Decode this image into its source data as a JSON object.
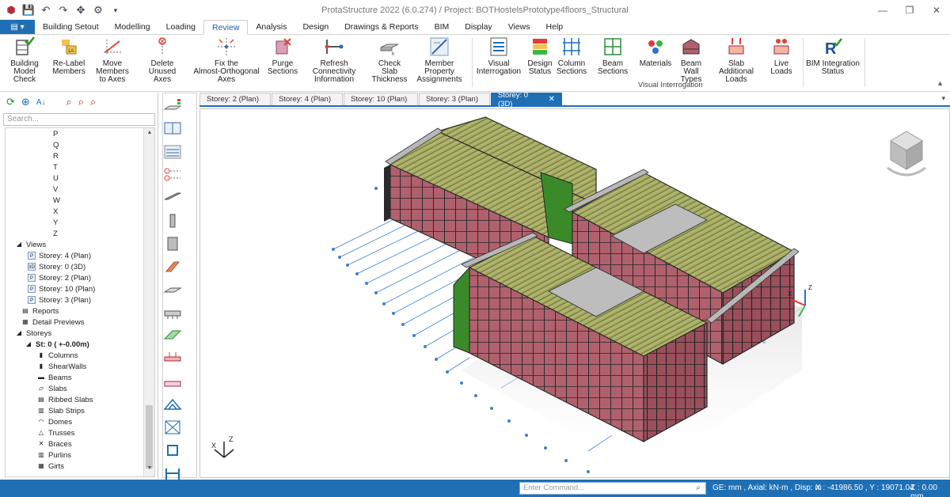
{
  "titlebar": {
    "title": "ProtaStructure 2022 (6.0.274) / Project: BOTHostelsPrototype4floors_Structural",
    "quick_icons": [
      "app-logo-icon",
      "save-icon",
      "undo-icon",
      "redo-icon",
      "tools-icon",
      "settings-icon",
      "customize-icon"
    ],
    "min": "—",
    "restore": "❐",
    "close": "✕"
  },
  "menu": {
    "file_label": "▤ ▾",
    "tabs": [
      "Building Setout",
      "Modelling",
      "Loading",
      "Review",
      "Analysis",
      "Design",
      "Drawings & Reports",
      "BIM",
      "Display",
      "Views",
      "Help"
    ],
    "active": "Review"
  },
  "ribbon": {
    "buttons": [
      {
        "id": "building-model-check",
        "line1": "Building",
        "line2": "Model Check"
      },
      {
        "id": "relabel-members",
        "line1": "Re-Label",
        "line2": "Members"
      },
      {
        "id": "move-members",
        "line1": "Move Members",
        "line2": "to Axes"
      },
      {
        "id": "delete-unused-axes",
        "line1": "Delete",
        "line2": "Unused Axes"
      },
      {
        "id": "fix-axes",
        "line1": "Fix the",
        "line2": "Almost-Orthogonal Axes"
      },
      {
        "id": "purge-sections",
        "line1": "Purge",
        "line2": "Sections"
      },
      {
        "id": "refresh-connectivity",
        "line1": "Refresh Connectivity",
        "line2": "Information"
      },
      {
        "id": "check-slab-thickness",
        "line1": "Check Slab",
        "line2": "Thickness"
      },
      {
        "id": "member-property",
        "line1": "Member Property",
        "line2": "Assignments"
      },
      {
        "id": "visual-interrogation",
        "line1": "Visual",
        "line2": "Interrogation"
      },
      {
        "id": "design-status",
        "line1": "Design",
        "line2": "Status"
      },
      {
        "id": "column-sections",
        "line1": "Column",
        "line2": "Sections"
      },
      {
        "id": "beam-sections",
        "line1": "Beam Sections",
        "line2": ""
      },
      {
        "id": "materials",
        "line1": "Materials",
        "line2": ""
      },
      {
        "id": "beam-wall-types",
        "line1": "Beam Wall",
        "line2": "Types"
      },
      {
        "id": "slab-additional-loads",
        "line1": "Slab Additional",
        "line2": "Loads"
      },
      {
        "id": "live-loads",
        "line1": "Live Loads",
        "line2": ""
      },
      {
        "id": "bim-integration-status",
        "line1": "BIM Integration",
        "line2": "Status"
      }
    ],
    "group_label": "Visual Interrogation",
    "collapse": "▲"
  },
  "leftpanel": {
    "search_placeholder": "Search...",
    "tree": [
      {
        "indent": 46,
        "icon": "",
        "label": "P"
      },
      {
        "indent": 46,
        "icon": "",
        "label": "Q"
      },
      {
        "indent": 46,
        "icon": "",
        "label": "R"
      },
      {
        "indent": 46,
        "icon": "",
        "label": "T"
      },
      {
        "indent": 46,
        "icon": "",
        "label": "U"
      },
      {
        "indent": 46,
        "icon": "",
        "label": "V"
      },
      {
        "indent": 46,
        "icon": "",
        "label": "W"
      },
      {
        "indent": 46,
        "icon": "",
        "label": "X"
      },
      {
        "indent": 46,
        "icon": "",
        "label": "Y"
      },
      {
        "indent": 46,
        "icon": "",
        "label": "Z"
      },
      {
        "indent": 12,
        "icon": "◢",
        "label": "Views"
      },
      {
        "indent": 28,
        "icon": "P",
        "label": "Storey: 4 (Plan)"
      },
      {
        "indent": 28,
        "icon": "3D",
        "label": "Storey: 0 (3D)"
      },
      {
        "indent": 28,
        "icon": "P",
        "label": "Storey: 2 (Plan)"
      },
      {
        "indent": 28,
        "icon": "P",
        "label": "Storey: 10 (Plan)"
      },
      {
        "indent": 28,
        "icon": "P",
        "label": "Storey: 3 (Plan)"
      },
      {
        "indent": 20,
        "icon": "▤",
        "label": "Reports"
      },
      {
        "indent": 20,
        "icon": "▦",
        "label": "Detail Previews"
      },
      {
        "indent": 12,
        "icon": "◢",
        "label": "Storeys"
      },
      {
        "indent": 24,
        "icon": "◢",
        "label": "St: 0 ( +-0.00m)"
      },
      {
        "indent": 40,
        "icon": "▮",
        "label": "Columns"
      },
      {
        "indent": 40,
        "icon": "▮",
        "label": "ShearWalls"
      },
      {
        "indent": 40,
        "icon": "▬",
        "label": "Beams"
      },
      {
        "indent": 40,
        "icon": "▱",
        "label": "Slabs"
      },
      {
        "indent": 40,
        "icon": "▤",
        "label": "Ribbed Slabs"
      },
      {
        "indent": 40,
        "icon": "▥",
        "label": "Slab Strips"
      },
      {
        "indent": 40,
        "icon": "◠",
        "label": "Domes"
      },
      {
        "indent": 40,
        "icon": "△",
        "label": "Trusses"
      },
      {
        "indent": 40,
        "icon": "✕",
        "label": "Braces"
      },
      {
        "indent": 40,
        "icon": "▥",
        "label": "Purlins"
      },
      {
        "indent": 40,
        "icon": "▦",
        "label": "Girts"
      }
    ]
  },
  "doctabs": {
    "tabs": [
      "Storey: 2 (Plan)",
      "Storey: 4 (Plan)",
      "Storey: 10 (Plan)",
      "Storey: 3 (Plan)",
      "Storey: 0 (3D)"
    ],
    "active": "Storey: 0 (3D)",
    "close": "✕",
    "more": "▾"
  },
  "viewport": {
    "axis_x": "X",
    "axis_z": "Z",
    "colors": {
      "frame": "#2a2a2a",
      "wall": "#b0616d",
      "roof": "#9aa05a",
      "slab": "#b8b8b8",
      "grid": "#3f7fd0",
      "accent_green": "#3b8a2a"
    }
  },
  "statusbar": {
    "command_placeholder": "Enter Command...",
    "units": "GE: mm , Axial: kN-m , Disp: m",
    "coords": "X : -41986.50 , Y : 19071.04",
    "z": "Z : 0.00 mm"
  }
}
